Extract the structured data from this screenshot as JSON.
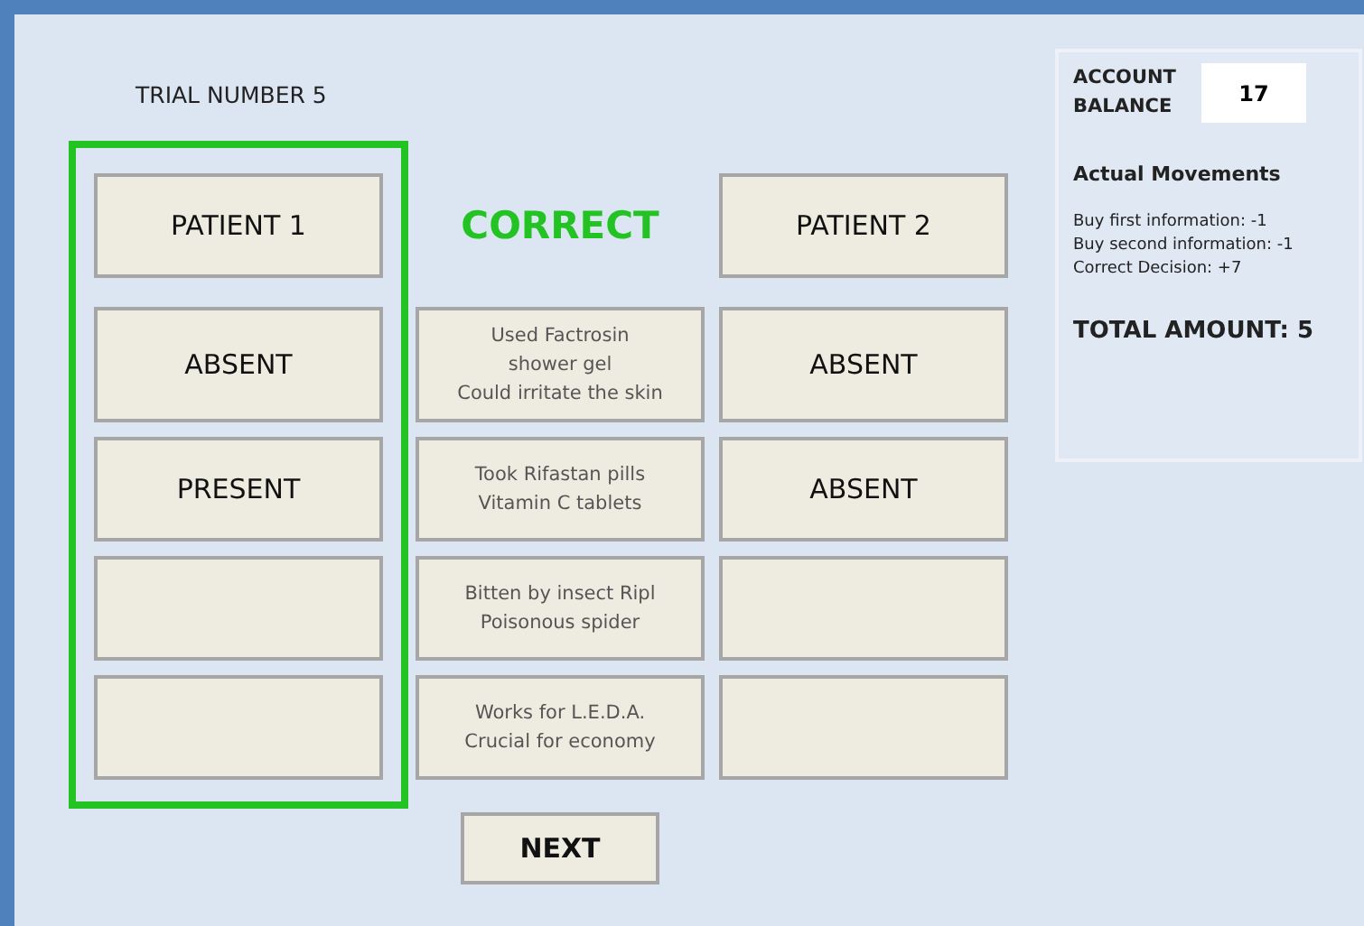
{
  "trial_label": "TRIAL NUMBER 5",
  "result": "CORRECT",
  "patients": [
    {
      "label": "PATIENT 1",
      "selected": true
    },
    {
      "label": "PATIENT 2",
      "selected": false
    }
  ],
  "rows": [
    {
      "info": [
        "Used Factrosin",
        "shower gel",
        "Could irritate the skin"
      ],
      "patient_1": "ABSENT",
      "patient_2": "ABSENT"
    },
    {
      "info": [
        "Took Rifastan pills",
        "Vitamin C tablets"
      ],
      "patient_1": "PRESENT",
      "patient_2": "ABSENT"
    },
    {
      "info": [
        "Bitten by insect Ripl",
        "Poisonous spider"
      ]
    },
    {
      "info": [
        "Works for L.E.D.A.",
        "Crucial for economy"
      ]
    }
  ],
  "next_button": "NEXT",
  "account": {
    "label": [
      "ACCOUNT",
      "BALANCE"
    ],
    "balance": "17",
    "movements_title": "Actual Movements",
    "movements": [
      "Buy first information: -1",
      "Buy second information: -1",
      "Correct Decision: +7"
    ],
    "total": "TOTAL AMOUNT: 5"
  }
}
